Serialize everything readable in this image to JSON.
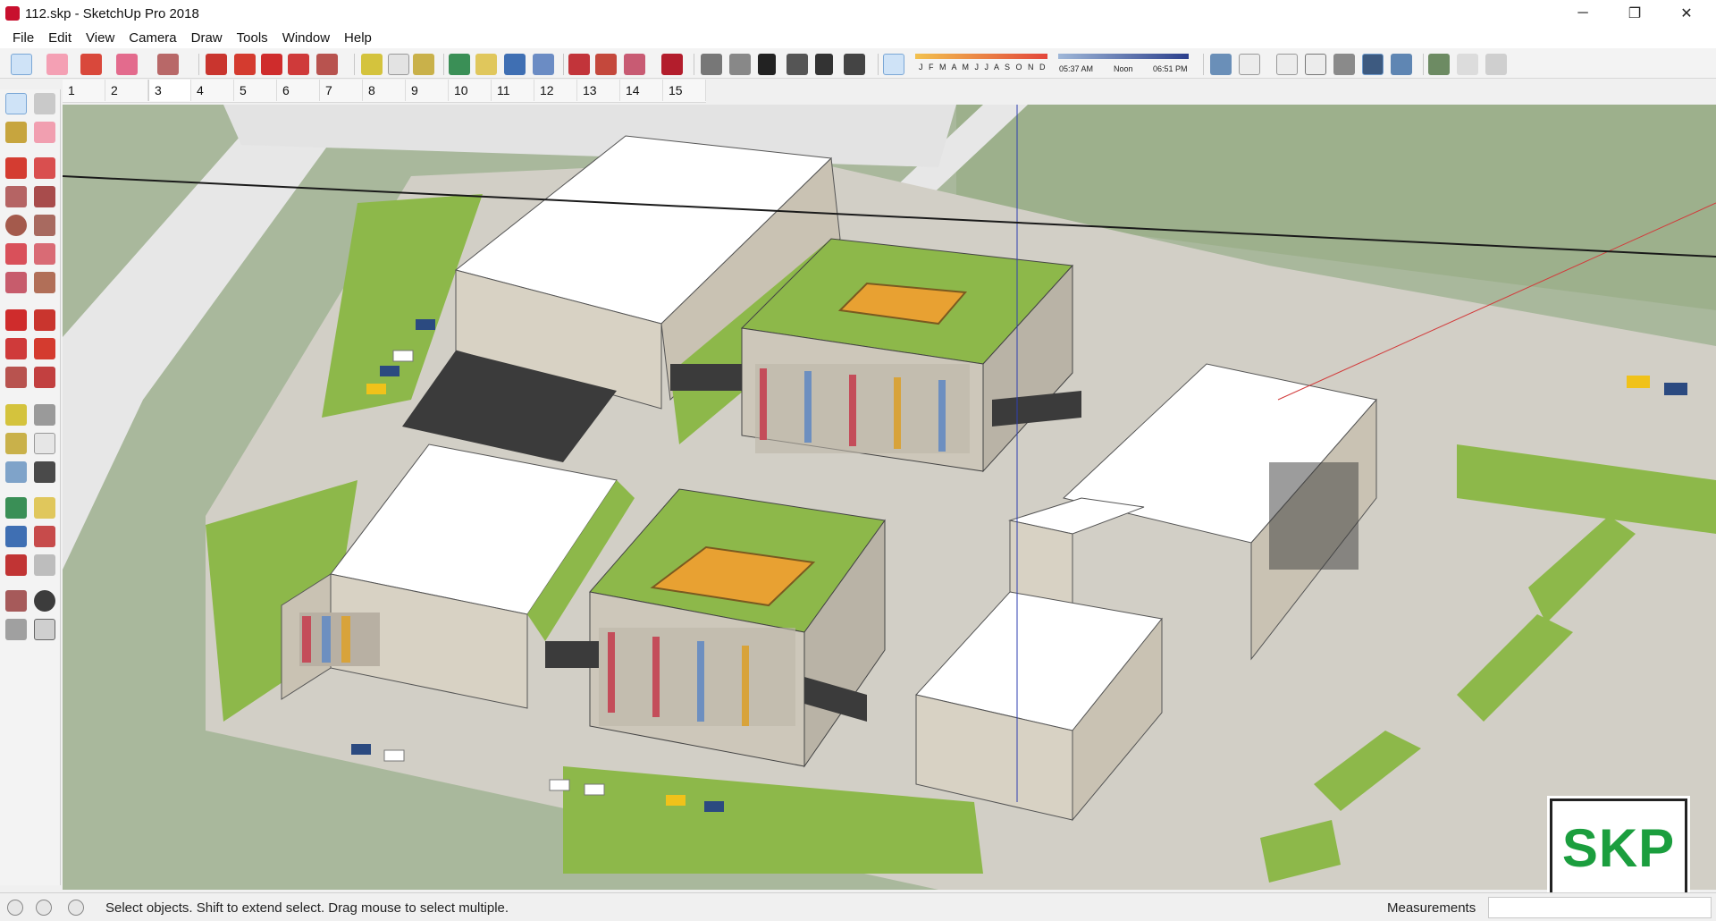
{
  "window": {
    "title": "112.skp - SketchUp Pro 2018",
    "minimize": "─",
    "maximize": "❐",
    "close": "✕"
  },
  "menu": [
    "File",
    "Edit",
    "View",
    "Camera",
    "Draw",
    "Tools",
    "Window",
    "Help"
  ],
  "toolbar": {
    "tools": [
      "select-icon",
      "eraser-icon",
      "pencil-icon",
      "paint-bucket-icon",
      "push-pull-icon",
      "follow-me-icon",
      "move-icon",
      "rotate-icon",
      "scale-icon",
      "tape-measure-icon",
      "text-icon",
      "paint-icon",
      "orbit-icon",
      "pan-icon",
      "zoom-icon",
      "zoom-extents-icon",
      "warehouse-icon",
      "component-icon",
      "extension-icon",
      "ruby-icon",
      "iso-view-icon",
      "top-view-icon",
      "front-view-icon",
      "right-view-icon",
      "back-view-icon",
      "left-view-icon",
      "shadows-icon",
      "xray-icon",
      "wireframe-icon",
      "hidden-line-icon",
      "shaded-icon",
      "textured-icon",
      "monochrome-icon",
      "location-icon",
      "sandbox-icon",
      "terrain-icon"
    ],
    "shadow_months": "J F M A M J J A S O N D",
    "shadow_time_start": "05:37 AM",
    "shadow_time_mid": "Noon",
    "shadow_time_end": "06:51 PM"
  },
  "scenes": [
    "1",
    "2",
    "3",
    "4",
    "5",
    "6",
    "7",
    "8",
    "9",
    "10",
    "11",
    "12",
    "13",
    "14",
    "15"
  ],
  "active_scene": "3",
  "left_tools": [
    "select",
    "component",
    "paint-bucket",
    "eraser",
    "pencil",
    "freehand",
    "rectangle",
    "rotated-rectangle",
    "circle",
    "polygon",
    "arc",
    "arc-3pt",
    "pie",
    "pie-alt",
    "move",
    "push-pull",
    "rotate",
    "follow-me",
    "scale",
    "offset",
    "tape-measure",
    "text",
    "axes",
    "dimension",
    "section-plane",
    "orbit",
    "pan",
    "zoom",
    "zoom-window",
    "zoom-extents",
    "previous-view",
    "position-camera",
    "look-around",
    "walk",
    "sandbox"
  ],
  "status": {
    "hint": "Select objects. Shift to extend select. Drag mouse to select multiple.",
    "measurements_label": "Measurements",
    "measurements_value": ""
  },
  "badge": {
    "text": "SKP"
  },
  "colors": {
    "brand": "#c8102e",
    "badge_text": "#1b9e3e",
    "badge_bar": "#8b0f6c",
    "lawn": "#8db84a",
    "roof": "#ffffff",
    "courtyard": "#e8a132",
    "pavement": "#c9c6bd",
    "facade": "#d8d2c4",
    "dark_roof": "#3b3b3b",
    "road": "#e6e6e6",
    "ground": "#a8b79a"
  }
}
